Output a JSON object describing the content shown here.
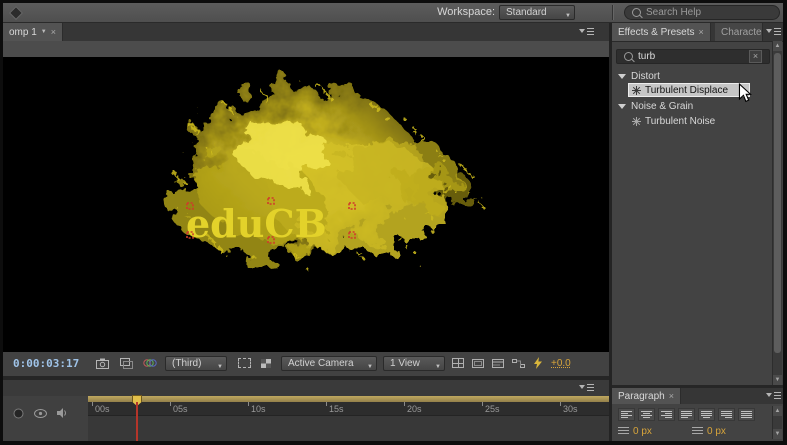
{
  "icons": {
    "chevron_down": "▼",
    "close": "×",
    "scroll_up": "▲",
    "scroll_down": "▼"
  },
  "topbar": {
    "workspace_label": "Workspace:",
    "workspace_value": "Standard",
    "search_placeholder": "Search Help"
  },
  "comp_panel": {
    "tab_label": "omp 1",
    "canvas_text": "eduCB",
    "controls": {
      "timecode": "0:00:03:17",
      "resolution": "(Third)",
      "camera": "Active Camera",
      "view": "1 View",
      "exposure": "+0.0"
    }
  },
  "timeline_panel": {
    "ticks": [
      "00s",
      "05s",
      "10s",
      "15s",
      "20s",
      "25s",
      "30s"
    ]
  },
  "effects_panel": {
    "tab_label": "Effects & Presets",
    "neighbor_tab_label": "Characte",
    "search_value": "turb",
    "groups": [
      {
        "label": "Distort",
        "items": [
          {
            "label": "Turbulent Displace",
            "selected": true
          }
        ]
      },
      {
        "label": "Noise & Grain",
        "items": [
          {
            "label": "Turbulent Noise",
            "selected": false
          }
        ]
      }
    ]
  },
  "paragraph_panel": {
    "tab_label": "Paragraph",
    "indent_fields": [
      {
        "value": "0 px"
      },
      {
        "value": "0 px"
      }
    ]
  },
  "colors": {
    "accent_gold": "#d7a43b",
    "timecode_blue": "#9fc3e8",
    "particle_yellow": "#d6c31f",
    "selection_red": "#c83232",
    "highlight_bg": "#c6c6c6"
  }
}
